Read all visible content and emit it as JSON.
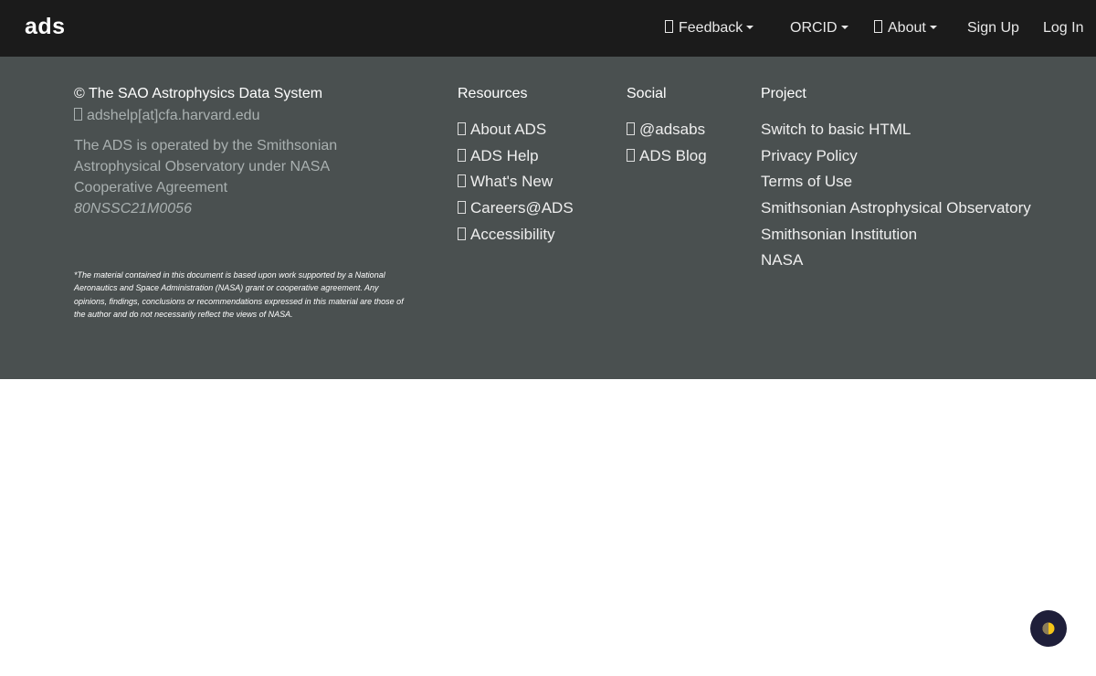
{
  "navbar": {
    "brand": "ads",
    "items": [
      {
        "label": "Feedback",
        "icon": "comment-icon",
        "dropdown": true
      },
      {
        "label": "ORCID",
        "dropdown": true
      },
      {
        "label": "About",
        "icon": "info-icon",
        "dropdown": true
      },
      {
        "label": "Sign Up"
      },
      {
        "label": "Log In"
      }
    ]
  },
  "footer": {
    "about": {
      "title": "© The SAO Astrophysics Data System",
      "email": "adshelp[at]cfa.harvard.edu",
      "operated_text": "The ADS is operated by the Smithsonian Astrophysical Observatory under NASA Cooperative Agreement",
      "agreement_number": "80NSSC21M0056",
      "disclaimer": "*The material contained in this document is based upon work supported by a National Aeronautics and Space Administration (NASA) grant or cooperative agreement. Any opinions, findings, conclusions or recommendations expressed in this material are those of the author and do not necessarily reflect the views of NASA."
    },
    "resources": {
      "heading": "Resources",
      "links": [
        "About ADS",
        "ADS Help",
        "What's New",
        "Careers@ADS",
        "Accessibility"
      ]
    },
    "social": {
      "heading": "Social",
      "links": [
        "@adsabs",
        "ADS Blog"
      ]
    },
    "project": {
      "heading": "Project",
      "links": [
        "Switch to basic HTML",
        "Privacy Policy",
        "Terms of Use",
        "Smithsonian Astrophysical Observatory",
        "Smithsonian Institution",
        "NASA"
      ]
    }
  },
  "theme_toggle": {
    "icon": "half-moon-icon"
  },
  "colors": {
    "navbar": "#1b1b1b",
    "footer": "#4a5050",
    "theme_button": "#1f1f3a",
    "accent": "#f5c518"
  }
}
